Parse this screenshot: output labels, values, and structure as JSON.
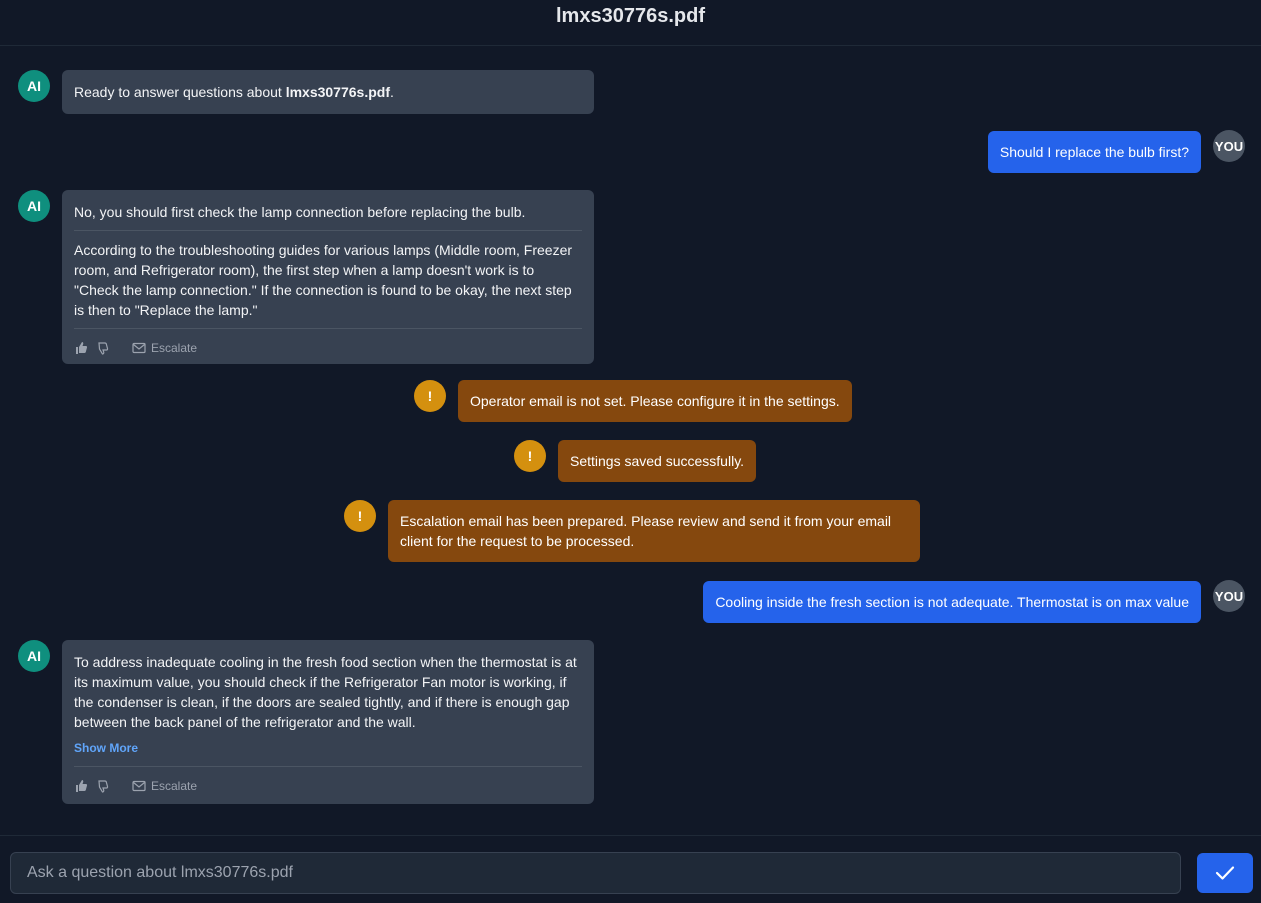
{
  "header": {
    "title": "lmxs30776s.pdf"
  },
  "avatars": {
    "ai": "AI",
    "you": "YOU",
    "warn": "!"
  },
  "messages": {
    "m1": {
      "prefix": "Ready to answer questions about ",
      "bold": "lmxs30776s.pdf",
      "suffix": "."
    },
    "m2": {
      "text": "Should I replace the bulb first?"
    },
    "m3": {
      "summary": "No, you should first check the lamp connection before replacing the bulb.",
      "detail": "According to the troubleshooting guides for various lamps (Middle room, Freezer room, and Refrigerator room), the first step when a lamp doesn't work is to \"Check the lamp connection.\" If the connection is found to be okay, the next step is then to \"Replace the lamp.\""
    },
    "m4": {
      "text": "Operator email is not set. Please configure it in the settings."
    },
    "m5": {
      "text": "Settings saved successfully."
    },
    "m6": {
      "text": "Escalation email has been prepared. Please review and send it from your email client for the request to be processed."
    },
    "m7": {
      "text": "Cooling inside the fresh section is not adequate. Thermostat is on max value"
    },
    "m8": {
      "text": "To address inadequate cooling in the fresh food section when the thermostat is at its maximum value, you should check if the Refrigerator Fan motor is working, if the condenser is clean, if the doors are sealed tightly, and if there is enough gap between the back panel of the refrigerator and the wall.",
      "show_more": "Show More"
    }
  },
  "actions": {
    "escalate_label": "Escalate"
  },
  "composer": {
    "placeholder": "Ask a question about lmxs30776s.pdf"
  },
  "colors": {
    "ai_avatar": "#0f8f7e",
    "user_bubble": "#2563eb",
    "system_bubble": "#85480e",
    "warn_avatar": "#d4900f"
  }
}
